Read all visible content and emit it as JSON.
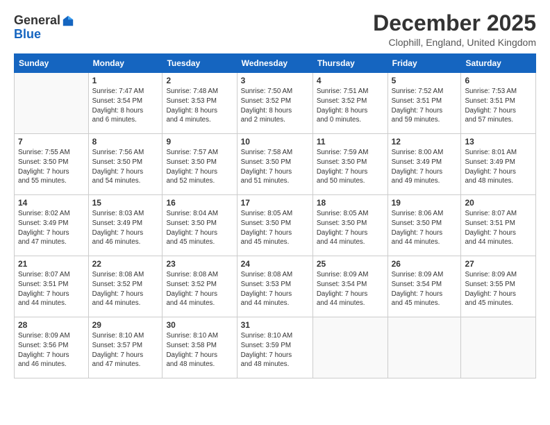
{
  "header": {
    "logo_general": "General",
    "logo_blue": "Blue",
    "month_title": "December 2025",
    "location": "Clophill, England, United Kingdom"
  },
  "days_of_week": [
    "Sunday",
    "Monday",
    "Tuesday",
    "Wednesday",
    "Thursday",
    "Friday",
    "Saturday"
  ],
  "weeks": [
    [
      {
        "day": "",
        "info": ""
      },
      {
        "day": "1",
        "info": "Sunrise: 7:47 AM\nSunset: 3:54 PM\nDaylight: 8 hours\nand 6 minutes."
      },
      {
        "day": "2",
        "info": "Sunrise: 7:48 AM\nSunset: 3:53 PM\nDaylight: 8 hours\nand 4 minutes."
      },
      {
        "day": "3",
        "info": "Sunrise: 7:50 AM\nSunset: 3:52 PM\nDaylight: 8 hours\nand 2 minutes."
      },
      {
        "day": "4",
        "info": "Sunrise: 7:51 AM\nSunset: 3:52 PM\nDaylight: 8 hours\nand 0 minutes."
      },
      {
        "day": "5",
        "info": "Sunrise: 7:52 AM\nSunset: 3:51 PM\nDaylight: 7 hours\nand 59 minutes."
      },
      {
        "day": "6",
        "info": "Sunrise: 7:53 AM\nSunset: 3:51 PM\nDaylight: 7 hours\nand 57 minutes."
      }
    ],
    [
      {
        "day": "7",
        "info": "Sunrise: 7:55 AM\nSunset: 3:50 PM\nDaylight: 7 hours\nand 55 minutes."
      },
      {
        "day": "8",
        "info": "Sunrise: 7:56 AM\nSunset: 3:50 PM\nDaylight: 7 hours\nand 54 minutes."
      },
      {
        "day": "9",
        "info": "Sunrise: 7:57 AM\nSunset: 3:50 PM\nDaylight: 7 hours\nand 52 minutes."
      },
      {
        "day": "10",
        "info": "Sunrise: 7:58 AM\nSunset: 3:50 PM\nDaylight: 7 hours\nand 51 minutes."
      },
      {
        "day": "11",
        "info": "Sunrise: 7:59 AM\nSunset: 3:50 PM\nDaylight: 7 hours\nand 50 minutes."
      },
      {
        "day": "12",
        "info": "Sunrise: 8:00 AM\nSunset: 3:49 PM\nDaylight: 7 hours\nand 49 minutes."
      },
      {
        "day": "13",
        "info": "Sunrise: 8:01 AM\nSunset: 3:49 PM\nDaylight: 7 hours\nand 48 minutes."
      }
    ],
    [
      {
        "day": "14",
        "info": "Sunrise: 8:02 AM\nSunset: 3:49 PM\nDaylight: 7 hours\nand 47 minutes."
      },
      {
        "day": "15",
        "info": "Sunrise: 8:03 AM\nSunset: 3:49 PM\nDaylight: 7 hours\nand 46 minutes."
      },
      {
        "day": "16",
        "info": "Sunrise: 8:04 AM\nSunset: 3:50 PM\nDaylight: 7 hours\nand 45 minutes."
      },
      {
        "day": "17",
        "info": "Sunrise: 8:05 AM\nSunset: 3:50 PM\nDaylight: 7 hours\nand 45 minutes."
      },
      {
        "day": "18",
        "info": "Sunrise: 8:05 AM\nSunset: 3:50 PM\nDaylight: 7 hours\nand 44 minutes."
      },
      {
        "day": "19",
        "info": "Sunrise: 8:06 AM\nSunset: 3:50 PM\nDaylight: 7 hours\nand 44 minutes."
      },
      {
        "day": "20",
        "info": "Sunrise: 8:07 AM\nSunset: 3:51 PM\nDaylight: 7 hours\nand 44 minutes."
      }
    ],
    [
      {
        "day": "21",
        "info": "Sunrise: 8:07 AM\nSunset: 3:51 PM\nDaylight: 7 hours\nand 44 minutes."
      },
      {
        "day": "22",
        "info": "Sunrise: 8:08 AM\nSunset: 3:52 PM\nDaylight: 7 hours\nand 44 minutes."
      },
      {
        "day": "23",
        "info": "Sunrise: 8:08 AM\nSunset: 3:52 PM\nDaylight: 7 hours\nand 44 minutes."
      },
      {
        "day": "24",
        "info": "Sunrise: 8:08 AM\nSunset: 3:53 PM\nDaylight: 7 hours\nand 44 minutes."
      },
      {
        "day": "25",
        "info": "Sunrise: 8:09 AM\nSunset: 3:54 PM\nDaylight: 7 hours\nand 44 minutes."
      },
      {
        "day": "26",
        "info": "Sunrise: 8:09 AM\nSunset: 3:54 PM\nDaylight: 7 hours\nand 45 minutes."
      },
      {
        "day": "27",
        "info": "Sunrise: 8:09 AM\nSunset: 3:55 PM\nDaylight: 7 hours\nand 45 minutes."
      }
    ],
    [
      {
        "day": "28",
        "info": "Sunrise: 8:09 AM\nSunset: 3:56 PM\nDaylight: 7 hours\nand 46 minutes."
      },
      {
        "day": "29",
        "info": "Sunrise: 8:10 AM\nSunset: 3:57 PM\nDaylight: 7 hours\nand 47 minutes."
      },
      {
        "day": "30",
        "info": "Sunrise: 8:10 AM\nSunset: 3:58 PM\nDaylight: 7 hours\nand 48 minutes."
      },
      {
        "day": "31",
        "info": "Sunrise: 8:10 AM\nSunset: 3:59 PM\nDaylight: 7 hours\nand 48 minutes."
      },
      {
        "day": "",
        "info": ""
      },
      {
        "day": "",
        "info": ""
      },
      {
        "day": "",
        "info": ""
      }
    ]
  ]
}
